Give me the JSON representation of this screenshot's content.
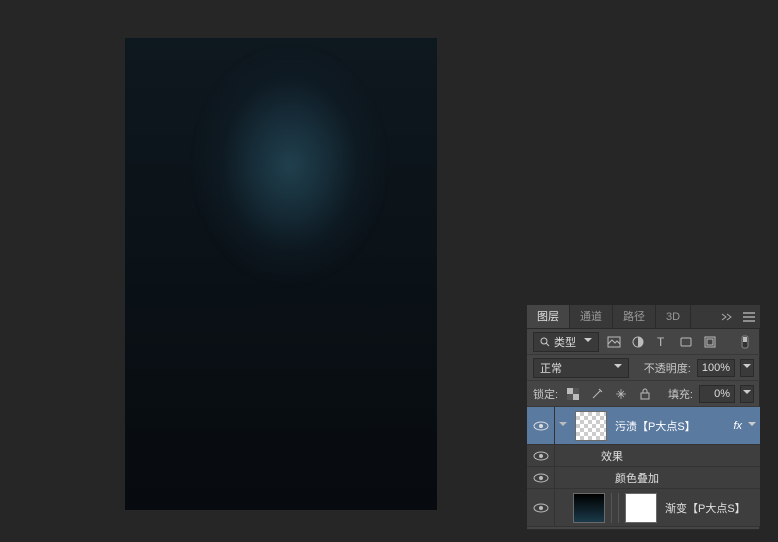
{
  "tabs": {
    "layers": "图层",
    "channels": "通道",
    "paths": "路径",
    "threeD": "3D"
  },
  "filter": {
    "kind": "类型"
  },
  "blend": {
    "mode": "正常",
    "opacity_label": "不透明度:",
    "opacity_value": "100%"
  },
  "lock": {
    "label": "锁定:",
    "fill_label": "填充:",
    "fill_value": "0%"
  },
  "layers": {
    "l1": {
      "name": "污渍【P大点S】",
      "fx": "fx"
    },
    "effects": "效果",
    "color_overlay": "颜色叠加",
    "l2": {
      "name": "渐变【P大点S】"
    }
  },
  "icons": {
    "search": "search-icon",
    "image": "image-icon",
    "adjust": "adjust-icon",
    "type": "type-icon",
    "shape": "shape-icon",
    "smart": "smart-icon",
    "eye": "eye-icon",
    "menu": "menu-icon",
    "collapse": "collapse-icon"
  }
}
